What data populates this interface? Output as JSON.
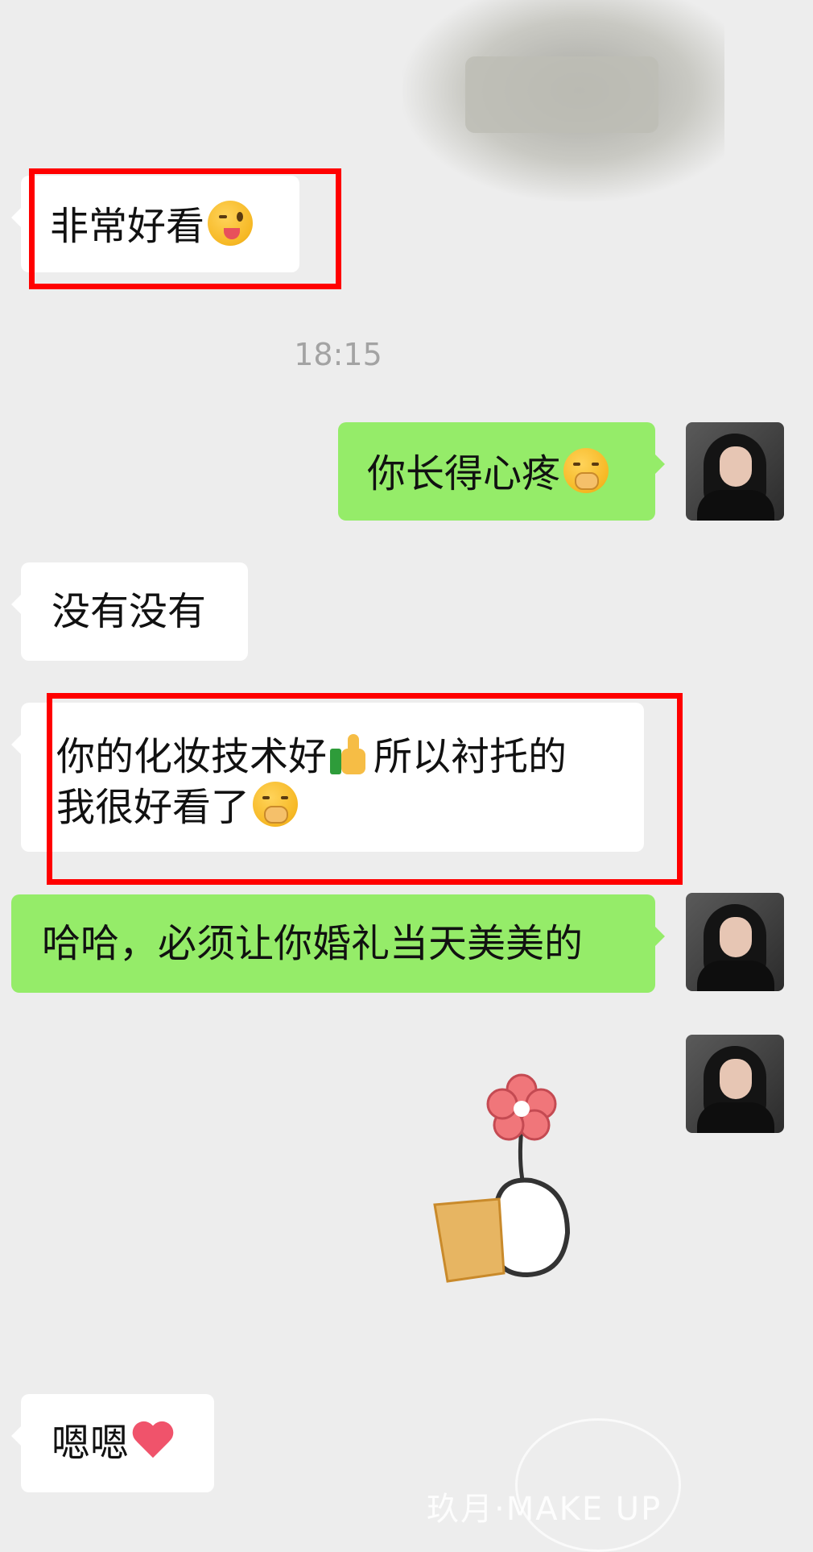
{
  "messages": [
    {
      "side": "left",
      "text": "非常好看",
      "emoji": "winking-tongue-face"
    },
    {
      "type": "time",
      "text": "18:15"
    },
    {
      "side": "right",
      "text": "你长得心疼",
      "emoji": "face-with-hand-over-mouth"
    },
    {
      "side": "left",
      "text": "没有没有"
    },
    {
      "side": "left",
      "line1_a": "你的化妆技术好",
      "line1_b": "所以衬托的",
      "line2": "我很好看了",
      "emoji": [
        "thumbs-up",
        "face-with-hand-over-mouth"
      ]
    },
    {
      "side": "right",
      "text": "哈哈，必须让你婚礼当天美美的"
    },
    {
      "side": "right",
      "type": "sticker",
      "sticker": "hand-holding-flower"
    },
    {
      "side": "left",
      "text": "嗯嗯",
      "emoji": "red-heart"
    }
  ],
  "watermark": {
    "brand": "玖月·MAKE UP"
  },
  "colors": {
    "background": "#ededed",
    "incoming_bubble": "#ffffff",
    "outgoing_bubble": "#95ec69",
    "highlight_box": "#ff0000"
  }
}
